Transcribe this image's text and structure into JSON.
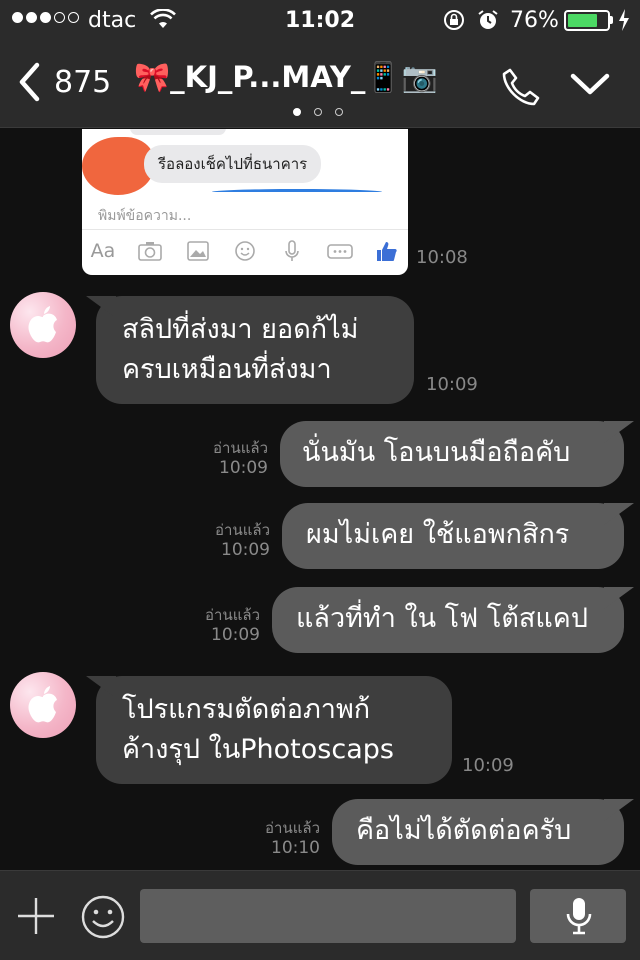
{
  "status_bar": {
    "carrier": "dtac",
    "time": "11:02",
    "battery_percent": "76%",
    "battery_level": 0.76,
    "signal_bars": 3,
    "signal_total": 5,
    "icons": [
      "wifi-icon",
      "orientation-lock-icon",
      "alarm-icon",
      "battery-icon",
      "charging-icon"
    ]
  },
  "header": {
    "back_count": "875",
    "title": "🎀_KJ_P...MAY_📱📷",
    "page_indicator_count": 3,
    "page_indicator_active": 0,
    "icons": [
      "back-chevron-icon",
      "phone-icon",
      "chevron-down-icon"
    ]
  },
  "shared_screenshot": {
    "bubble_text": "รีอลองเช็คไปที่ธนาคาร",
    "input_placeholder": "พิมพ์ข้อความ...",
    "toolbar": [
      "Aa",
      "camera-icon",
      "gallery-icon",
      "emoji-icon",
      "mic-icon",
      "more-icon",
      "like-icon"
    ],
    "colors": {
      "blob": "#f0663e",
      "accent": "#2e7de0"
    }
  },
  "messages": [
    {
      "type": "image",
      "time": "10:08"
    },
    {
      "type": "incoming",
      "lines": [
        "สลิปที่ส่งมา ยอดก้ไม่",
        "ครบเหมือนที่ส่งมา"
      ],
      "time": "10:09"
    },
    {
      "type": "outgoing",
      "text": "นั่นมัน โอนบนมือถือคับ",
      "read": "อ่านแล้ว",
      "time": "10:09"
    },
    {
      "type": "outgoing",
      "text": "ผมไม่เคย ใช้แอพกสิกร",
      "read": "อ่านแล้ว",
      "time": "10:09"
    },
    {
      "type": "outgoing",
      "text": "แล้วที่ทำ ใน โฟ โต้สแคป",
      "read": "อ่านแล้ว",
      "time": "10:09"
    },
    {
      "type": "incoming",
      "lines": [
        "โปรแกรมตัดต่อภาพก้",
        "ค้างรุป ในPhotoscaps"
      ],
      "time": "10:09"
    },
    {
      "type": "outgoing",
      "text": "คือไม่ได้ตัดต่อครับ",
      "read": "อ่านแล้ว",
      "time": "10:10"
    }
  ],
  "input_bar": {
    "message_value": "",
    "icons": [
      "plus-icon",
      "emoji-icon",
      "microphone-icon"
    ]
  },
  "colors": {
    "background": "#111111",
    "bar": "#2b2b2b",
    "incoming_bubble": "#3e3e3e",
    "outgoing_bubble": "#5b5b5b",
    "battery": "#4cd964"
  }
}
